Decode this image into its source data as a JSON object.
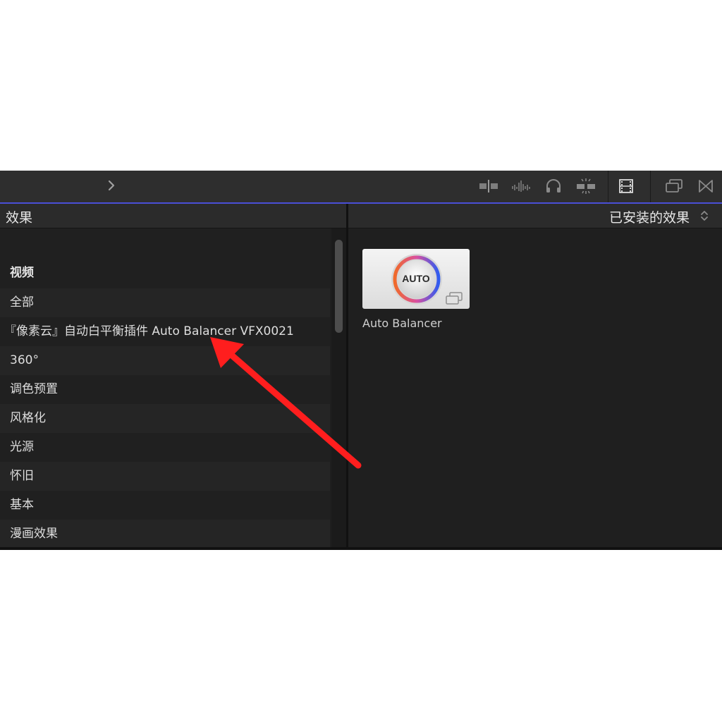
{
  "toolbar": {
    "icons": [
      "clip-split-icon",
      "audio-waveform-icon",
      "headphones-icon",
      "skimming-icon",
      "filmstrip-icon",
      "window-overlap-icon",
      "transitions-icon"
    ]
  },
  "left_panel": {
    "title": "效果",
    "group_label": "视频",
    "categories": [
      "全部",
      "『像素云』自动白平衡插件 Auto Balancer VFX0021",
      "360°",
      "调色预置",
      "风格化",
      "光源",
      "怀旧",
      "基本",
      "漫画效果"
    ]
  },
  "right_panel": {
    "title": "已安装的效果",
    "effect": {
      "thumb_text": "AUTO",
      "name": "Auto Balancer"
    }
  },
  "colors": {
    "accent": "#4a4fd6",
    "annotation": "#ff1e1e",
    "ring_orange": "#f06a2a",
    "ring_blue": "#2f5cf0"
  }
}
